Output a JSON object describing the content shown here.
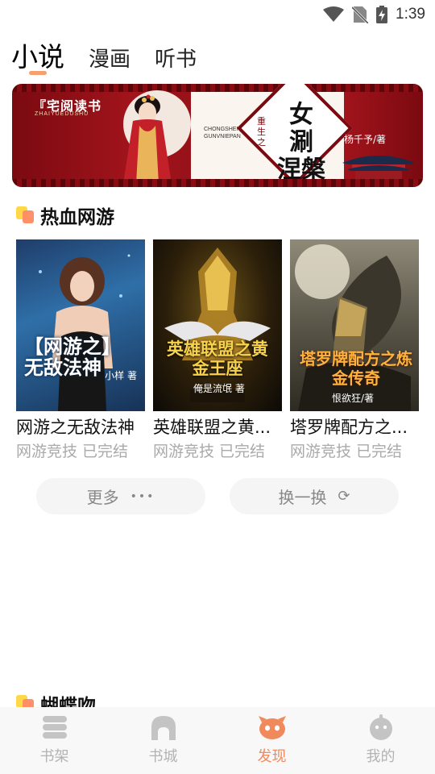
{
  "status_bar": {
    "time": "1:39"
  },
  "top_tabs": [
    "小说",
    "漫画",
    "听书"
  ],
  "banner": {
    "brand": "『宅阅读书",
    "brand_sub": "ZHAIYUEDUSHU",
    "title_prefix": "重生之",
    "title": "女 涮 涅槃",
    "title_en": "CHONGSHENGZHI GUNVNIEPAN",
    "author": "杨千予/著"
  },
  "section1": {
    "title": "热血网游"
  },
  "books": [
    {
      "title": "网游之无敌法神",
      "meta": "网游竞技 已完结",
      "cover_title": "【网游之】无敌法神",
      "cover_author": "小样 著"
    },
    {
      "title": "英雄联盟之黄...",
      "meta": "网游竞技 已完结",
      "cover_title": "英雄联盟之黄金王座",
      "cover_author": "俺是流氓 著"
    },
    {
      "title": "塔罗牌配方之...",
      "meta": "网游竞技 已完结",
      "cover_title": "塔罗牌配方之炼金传奇",
      "cover_author": "恨欲狂/著"
    }
  ],
  "buttons": {
    "more": "更多",
    "more_icon": "•••",
    "refresh": "换一换",
    "refresh_icon": "⟳"
  },
  "section2": {
    "title": "蝴蝶吻"
  },
  "bottom_nav": [
    {
      "label": "书架",
      "icon": "bookshelf-icon"
    },
    {
      "label": "书城",
      "icon": "bookstore-icon"
    },
    {
      "label": "发现",
      "icon": "discover-icon",
      "active": true
    },
    {
      "label": "我的",
      "icon": "profile-icon"
    }
  ],
  "colors": {
    "accent": "#f08a5d",
    "inactive": "#b3b3b3",
    "indicator": "#f4a070"
  }
}
